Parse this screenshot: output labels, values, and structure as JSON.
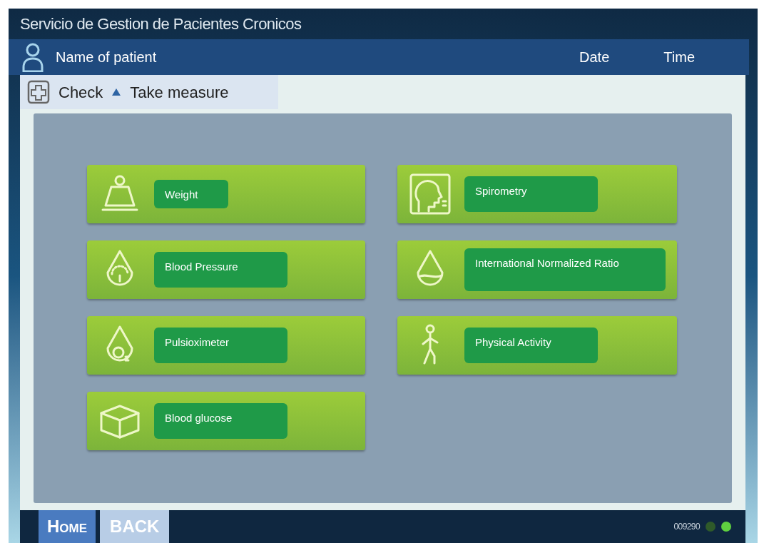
{
  "window": {
    "title": "Servicio de Gestion de Pacientes Cronicos"
  },
  "patient_bar": {
    "name": "Name of patient",
    "date": "Date",
    "time": "Time"
  },
  "breadcrumb": {
    "items": [
      "Check",
      "Take measure"
    ]
  },
  "measures": [
    {
      "kind": "weight",
      "label": "Weight"
    },
    {
      "kind": "spirometry",
      "label": "Spirometry"
    },
    {
      "kind": "pressure",
      "label": "Blood Pressure"
    },
    {
      "kind": "drop",
      "label": "International Normalized Ratio"
    },
    {
      "kind": "oxygen",
      "label": "Pulsioximeter"
    },
    {
      "kind": "walk",
      "label": "Physical Activity"
    },
    {
      "kind": "box",
      "label": "Blood glucose"
    }
  ],
  "footer": {
    "buttons": [
      {
        "kind": "home",
        "label": "Home"
      },
      {
        "kind": "back",
        "label": "BACK"
      }
    ],
    "code": "009290",
    "leds": [
      {
        "on": false
      },
      {
        "on": true
      }
    ]
  }
}
